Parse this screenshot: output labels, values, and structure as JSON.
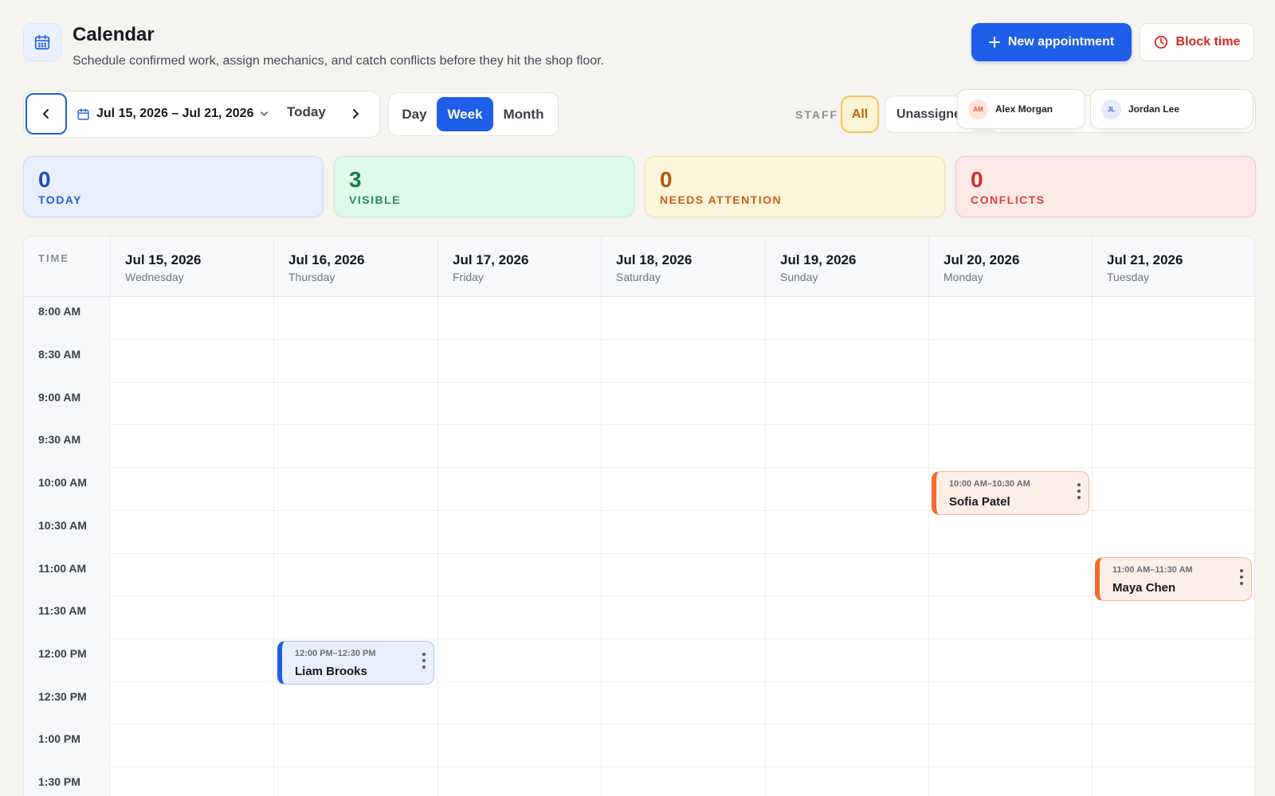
{
  "header": {
    "title": "Calendar",
    "subtitle": "Schedule confirmed work, assign mechanics, and catch conflicts before they hit the shop floor.",
    "new_appointment_label": "New appointment",
    "block_time_label": "Block time"
  },
  "toolbar": {
    "date_range": "Jul 15, 2026 – Jul 21, 2026",
    "today_label": "Today",
    "views": [
      "Day",
      "Week",
      "Month"
    ],
    "active_view": "Week",
    "staff_label": "STAFF",
    "staff_all": "All",
    "staff_unassigned": "Unassigned",
    "staff": [
      {
        "initials": "AM",
        "name": "Alex Morgan"
      },
      {
        "initials": "JL",
        "name": "Jordan Lee"
      }
    ]
  },
  "stats": [
    {
      "value": "0",
      "label": "TODAY"
    },
    {
      "value": "3",
      "label": "VISIBLE"
    },
    {
      "value": "0",
      "label": "NEEDS ATTENTION"
    },
    {
      "value": "0",
      "label": "CONFLICTS"
    }
  ],
  "calendar": {
    "time_header": "TIME",
    "days": [
      {
        "date": "Jul 15, 2026",
        "weekday": "Wednesday"
      },
      {
        "date": "Jul 16, 2026",
        "weekday": "Thursday"
      },
      {
        "date": "Jul 17, 2026",
        "weekday": "Friday"
      },
      {
        "date": "Jul 18, 2026",
        "weekday": "Saturday"
      },
      {
        "date": "Jul 19, 2026",
        "weekday": "Sunday"
      },
      {
        "date": "Jul 20, 2026",
        "weekday": "Monday"
      },
      {
        "date": "Jul 21, 2026",
        "weekday": "Tuesday"
      }
    ],
    "times": [
      "8:00 AM",
      "8:30 AM",
      "9:00 AM",
      "9:30 AM",
      "10:00 AM",
      "10:30 AM",
      "11:00 AM",
      "11:30 AM",
      "12:00 PM",
      "12:30 PM",
      "1:00 PM",
      "1:30 PM"
    ],
    "events": [
      {
        "time": "10:00 AM–10:30 AM",
        "name": "Sofia Patel"
      },
      {
        "time": "11:00 AM–11:30 AM",
        "name": "Maya Chen"
      },
      {
        "time": "12:00 PM–12:30 PM",
        "name": "Liam Brooks"
      }
    ]
  },
  "colors": {
    "accent": "#1f5ee8",
    "danger": "#d42a23",
    "event_orange": "#f26a2e",
    "event_blue": "#1f5ee8"
  },
  "icons": {
    "app": "calendar-icon",
    "new": "plus-icon",
    "block": "clock-icon",
    "prev": "chevron-left-icon",
    "next": "chevron-right-icon",
    "range": "calendar-icon",
    "dropdown": "chevron-down-icon",
    "event_menu": "more-vertical-icon"
  }
}
